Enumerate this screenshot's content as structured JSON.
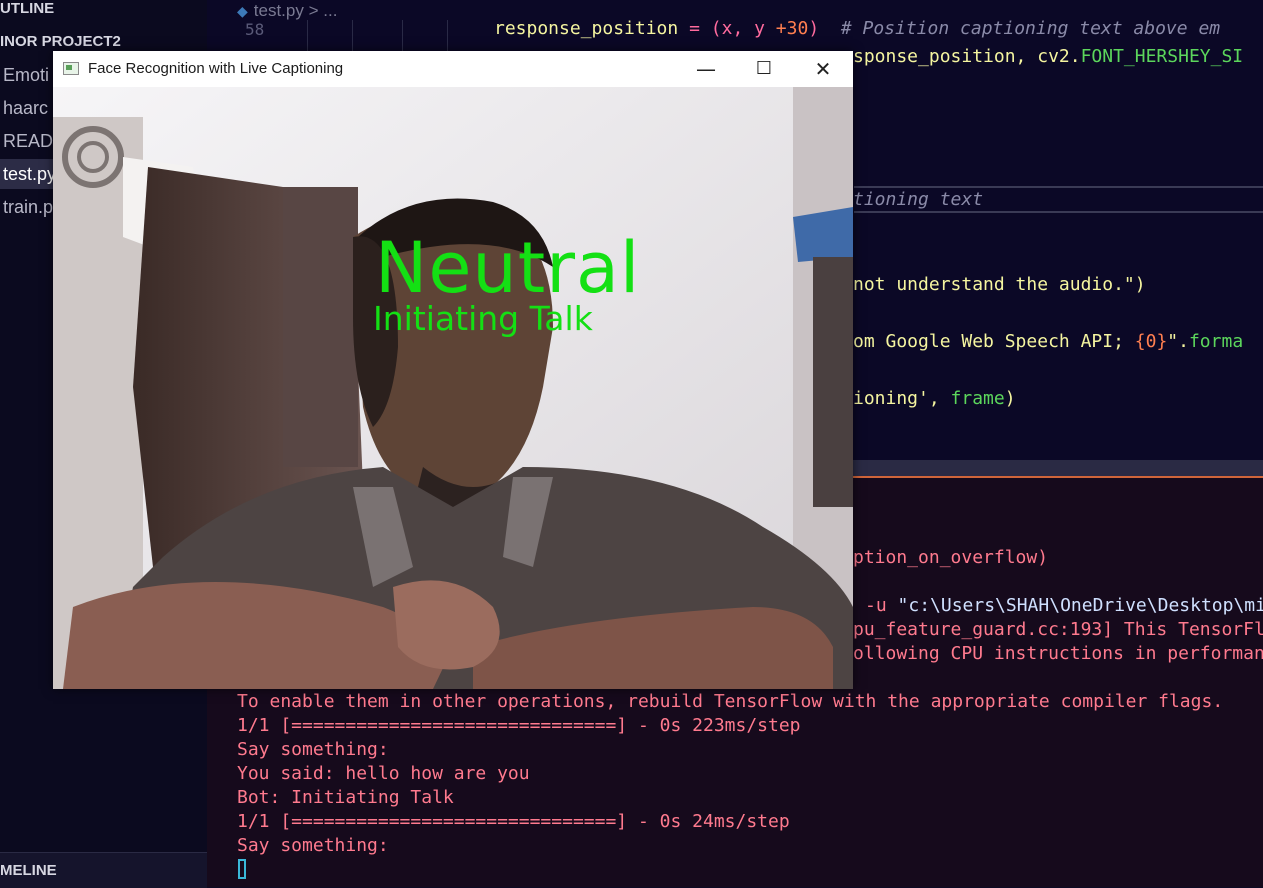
{
  "sidebar": {
    "outline_header": "UTLINE",
    "project_name": "INOR PROJECT2",
    "files": [
      "Emoti",
      "haarc",
      "READ",
      "test.py",
      "train.p"
    ],
    "active_file_index": 3,
    "timeline_header": "MELINE"
  },
  "editor": {
    "breadcrumb_file": "test.py",
    "breadcrumb_rest": "> ...",
    "line_number": "58",
    "lines": {
      "l58_a": "response_position ",
      "l58_b": "= ",
      "l58_c": "(x, y ",
      "l58_d": "+30",
      "l58_e": ")  ",
      "l58_comment": "# Position captioning text above em",
      "l59_a": "sponse_position, cv2.",
      "l59_b": "FONT_HERSHEY_SI",
      "l64_comment": "tioning text",
      "l67": "not understand the audio.\")",
      "l69_a": "om Google Web Speech API; ",
      "l69_b": "{0}",
      "l69_c": "\".",
      "l69_d": "forma",
      "l71_a": "ioning', ",
      "l71_b": "frame",
      "l71_c": ")"
    }
  },
  "terminal": {
    "lines": [
      "ption_on_overflow)",
      "-u ",
      "\"c:\\Users\\SHAH\\OneDrive\\Desktop\\mi",
      "pu_feature_guard.cc:193] This TensorFl",
      "ollowing CPU instructions in performan",
      "To enable them in other operations, rebuild TensorFlow with the appropriate compiler flags.",
      "1/1 [==============================] - 0s 223ms/step",
      "Say something:",
      "You said: hello how are you",
      "Bot: Initiating Talk",
      "1/1 [==============================] - 0s 24ms/step",
      "Say something:"
    ]
  },
  "window": {
    "title": "Face Recognition with Live Captioning",
    "minimize_glyph": "—",
    "maximize_glyph": "☐",
    "close_glyph": "✕",
    "caption_emotion": "Neutral",
    "caption_response": "Initiating Talk",
    "icon": "app-window-icon"
  },
  "colors": {
    "caption_green": "#14e014",
    "terminal_text": "#ff7a8e",
    "panel_accent": "#d0653a"
  }
}
